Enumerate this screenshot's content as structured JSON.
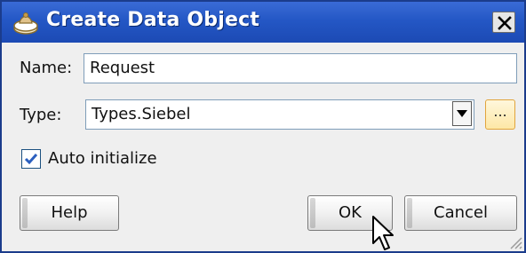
{
  "window": {
    "title": "Create Data Object",
    "icon": "data-object-icon",
    "close_icon": "close-icon"
  },
  "form": {
    "name_label": "Name:",
    "name_value": "Request",
    "type_label": "Type:",
    "type_value": "Types.Siebel",
    "browse_label": "...",
    "auto_init_label": "Auto initialize",
    "auto_init_checked": true
  },
  "buttons": {
    "help": "Help",
    "ok": "OK",
    "cancel": "Cancel"
  },
  "colors": {
    "titlebar": "#2457c5",
    "accent_browse": "#e1a43c",
    "check": "#2b5fbf"
  }
}
